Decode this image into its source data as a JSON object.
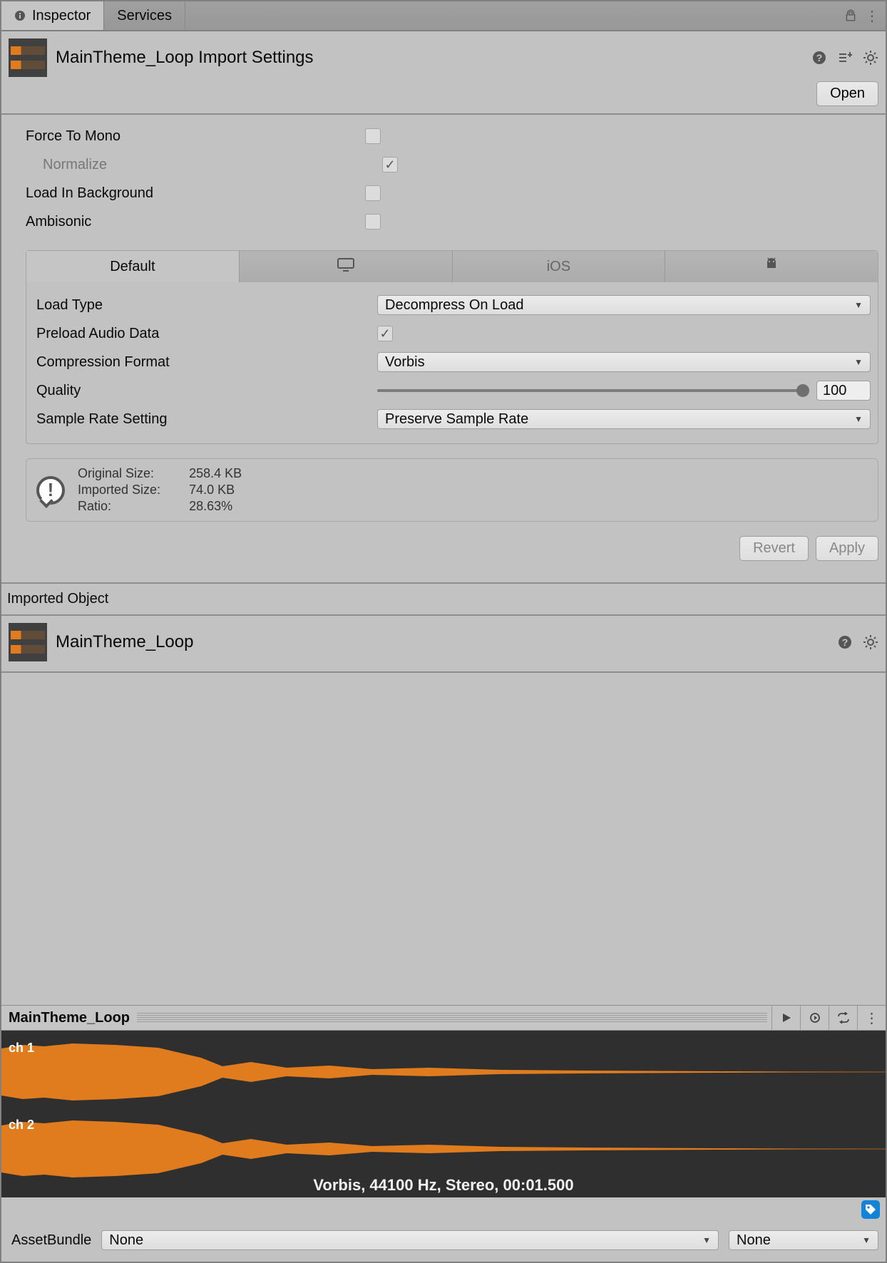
{
  "tabs": {
    "inspector": "Inspector",
    "services": "Services"
  },
  "header": {
    "title": "MainTheme_Loop Import Settings",
    "open": "Open"
  },
  "props": {
    "force_to_mono": "Force To Mono",
    "normalize": "Normalize",
    "load_in_background": "Load In Background",
    "ambisonic": "Ambisonic"
  },
  "platform_tabs": {
    "default": "Default",
    "ios": "iOS"
  },
  "settings": {
    "load_type_label": "Load Type",
    "load_type_value": "Decompress On Load",
    "preload_label": "Preload Audio Data",
    "compression_label": "Compression Format",
    "compression_value": "Vorbis",
    "quality_label": "Quality",
    "quality_value": "100",
    "samplerate_label": "Sample Rate Setting",
    "samplerate_value": "Preserve Sample Rate"
  },
  "info": {
    "labels": {
      "orig": "Original Size:",
      "imp": "Imported Size:",
      "ratio": "Ratio:"
    },
    "values": {
      "orig": "258.4 KB",
      "imp": "74.0 KB",
      "ratio": "28.63%"
    }
  },
  "buttons": {
    "revert": "Revert",
    "apply": "Apply"
  },
  "imported": {
    "section": "Imported Object",
    "title": "MainTheme_Loop"
  },
  "preview": {
    "name": "MainTheme_Loop",
    "ch1": "ch 1",
    "ch2": "ch 2",
    "caption": "Vorbis, 44100 Hz, Stereo, 00:01.500"
  },
  "footer": {
    "assetbundle": "AssetBundle",
    "none": "None"
  }
}
